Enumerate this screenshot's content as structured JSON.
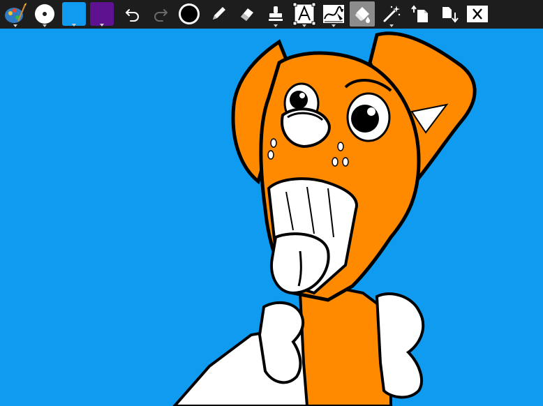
{
  "app": {
    "toolbar": {
      "tools": [
        "palette-tool",
        "brush-size-tool",
        "primary-color",
        "secondary-color",
        "undo",
        "redo",
        "line-width",
        "pencil-tool",
        "eraser-tool",
        "stamp-tool",
        "text-tool",
        "fill-pattern-tool",
        "paint-bucket-tool",
        "magic-wand-tool",
        "import-image",
        "save-export",
        "close"
      ]
    },
    "colors": {
      "toolbar_bg": "#1d1d1d",
      "primary": "#0f9bf0",
      "secondary": "#5e1290",
      "canvas_bg": "#0f9bf0",
      "fill_orange": "#ff8a00",
      "outline": "#000000",
      "white": "#ffffff"
    }
  }
}
